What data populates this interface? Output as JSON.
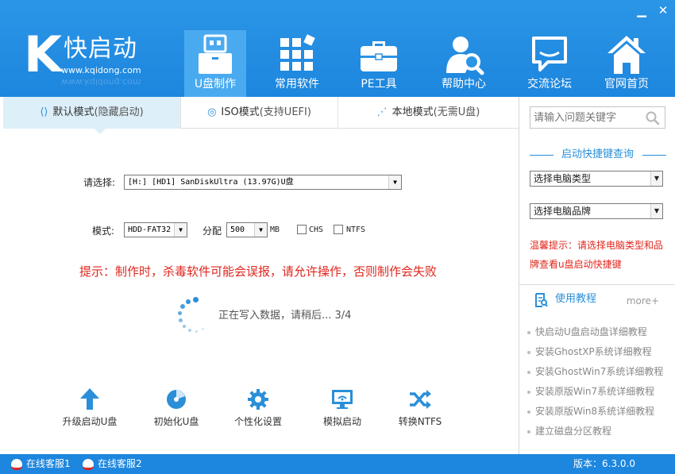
{
  "header": {
    "logo_letter": "K",
    "logo_name": "快启动",
    "logo_url": "www.kqidong.com",
    "minimize_glyph": "▁",
    "close_glyph": "✕",
    "nav": [
      {
        "label": "U盘制作",
        "icon": "usb-drive-icon",
        "active": true
      },
      {
        "label": "常用软件",
        "icon": "apps-grid-icon",
        "active": false
      },
      {
        "label": "PE工具",
        "icon": "briefcase-icon",
        "active": false
      },
      {
        "label": "帮助中心",
        "icon": "help-user-search-icon",
        "active": false
      },
      {
        "label": "交流论坛",
        "icon": "chat-bubble-icon",
        "active": false
      },
      {
        "label": "官网首页",
        "icon": "home-icon",
        "active": false
      }
    ]
  },
  "tabs": [
    {
      "label": "默认模式",
      "sub": "(隐藏启动)",
      "icon": "share-icon",
      "active": true
    },
    {
      "label": "ISO模式",
      "sub": "(支持UEFI)",
      "icon": "disc-icon",
      "active": false
    },
    {
      "label": "本地模式",
      "sub": "(无需U盘)",
      "icon": "signal-icon",
      "active": false
    }
  ],
  "form": {
    "select_label": "请选择:",
    "device_value": "[H:] [HD1] SanDiskUltra (13.97G)U盘",
    "mode_label": "模式:",
    "mode_value": "HDD-FAT32",
    "alloc_label": "分配",
    "alloc_value": "500",
    "alloc_unit": "MB",
    "chs_label": "CHS",
    "ntfs_label": "NTFS",
    "chs_checked": false,
    "ntfs_checked": false
  },
  "warning": "提示：制作时，杀毒软件可能会误报，请允许操作，否则制作会失败",
  "progress": {
    "text": "正在写入数据，请稍后... 3/4",
    "step": 3,
    "total": 4
  },
  "tools": [
    {
      "label": "升级启动U盘",
      "icon": "upload-arrow-icon"
    },
    {
      "label": "初始化U盘",
      "icon": "pie-disc-icon"
    },
    {
      "label": "个性化设置",
      "icon": "gear-icon"
    },
    {
      "label": "模拟启动",
      "icon": "monitor-wifi-icon"
    },
    {
      "label": "转换NTFS",
      "icon": "shuffle-icon"
    }
  ],
  "sidebar": {
    "search_placeholder": "请输入问题关键字",
    "shortcut_title": "启动快捷键查询",
    "computer_type": "选择电脑类型",
    "computer_brand": "选择电脑品牌",
    "tip": "温馨提示：请选择电脑类型和品牌查看u盘启动快捷键",
    "guide_title": "使用教程",
    "more": "more+",
    "links": [
      "快启动U盘启动盘详细教程",
      "安装GhostXP系统详细教程",
      "安装GhostWin7系统详细教程",
      "安装原版Win7系统详细教程",
      "安装原版Win8系统详细教程",
      "建立磁盘分区教程"
    ]
  },
  "footer": {
    "support1": "在线客服1",
    "support2": "在线客服2",
    "version": "版本：6.3.0.0"
  },
  "colors": {
    "header_blue": "#1d86de",
    "accent_blue": "#2a8fd8",
    "warning_red": "#e0261d",
    "active_tab": "#ddeff9"
  }
}
